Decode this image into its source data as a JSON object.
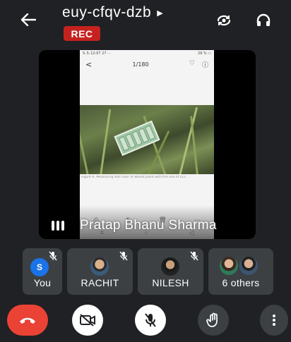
{
  "meeting": {
    "code": "euy-cfqv-dzb",
    "rec_label": "REC"
  },
  "header": {
    "back_icon": "back-arrow-icon",
    "switch_camera_icon": "switch-camera-icon",
    "audio_output_icon": "headphones-icon"
  },
  "presentation": {
    "presenter_name": "Pratap Bhanu Sharma",
    "screen": {
      "status_time": "5ₗ 5ₗ 12:07 27 ···",
      "status_right": "29 % ▭",
      "back_glyph": "<",
      "page_indicator": "1/180",
      "caption": "Figure 6. Measuring leaf color of wheat plant with the use of LCC",
      "nav_icons": [
        "⎙",
        "✎",
        "🗑",
        "⋯"
      ],
      "sys_nav": [
        "≡",
        "○",
        "◁"
      ]
    }
  },
  "participants": [
    {
      "name": "You",
      "avatar_letter": "S",
      "avatar_color": "#1a73e8",
      "muted": true
    },
    {
      "name": "RACHIT",
      "muted": true
    },
    {
      "name": "NILESH",
      "muted": true
    },
    {
      "name": "6 others",
      "muted": false
    }
  ],
  "controls": {
    "end_call_icon": "end-call-icon",
    "camera_icon": "camera-off-icon",
    "mic_icon": "mic-off-icon",
    "raise_hand_icon": "raise-hand-icon",
    "more_icon": "more-vertical-icon"
  },
  "colors": {
    "background": "#202124",
    "rec_badge": "#c5221f",
    "end_call": "#ea4335",
    "tile": "#3c4043"
  }
}
